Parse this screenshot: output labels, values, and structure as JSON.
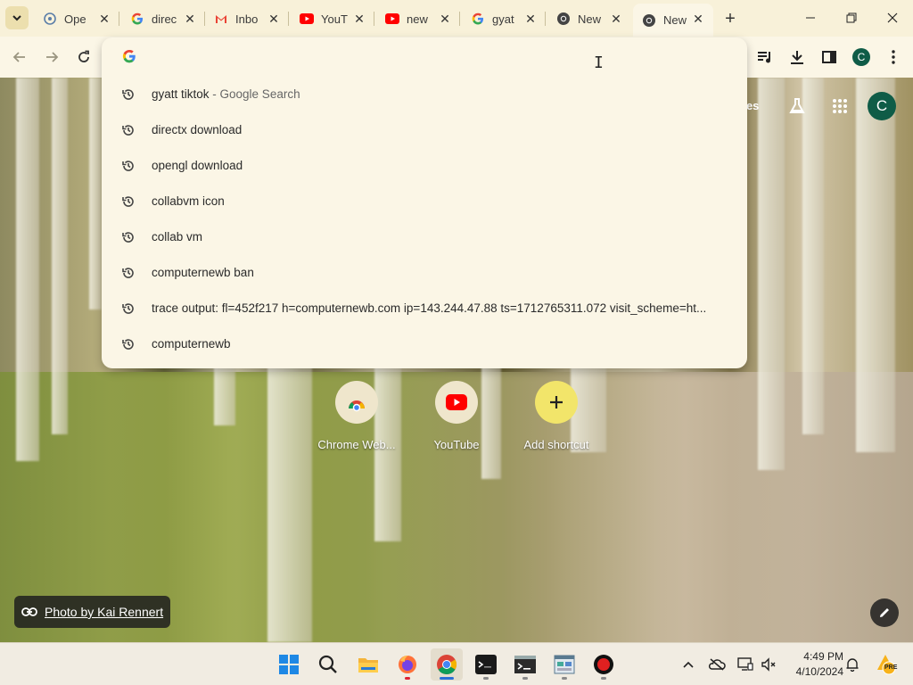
{
  "tabs": [
    {
      "title": "Ope",
      "icon": "openai-icon"
    },
    {
      "title": "direc",
      "icon": "google-icon"
    },
    {
      "title": "Inbo",
      "icon": "gmail-icon"
    },
    {
      "title": "YouT",
      "icon": "youtube-icon"
    },
    {
      "title": "new",
      "icon": "youtube-icon"
    },
    {
      "title": "gyat",
      "icon": "google-icon"
    },
    {
      "title": "New",
      "icon": "chrome-icon"
    },
    {
      "title": "New",
      "icon": "chrome-icon",
      "active": true
    }
  ],
  "toolbar": {
    "profile_initial": "C"
  },
  "omnibox": {
    "value": "",
    "suggestions": [
      {
        "text": "gyatt tiktok",
        "suffix": " - Google Search"
      },
      {
        "text": "directx download",
        "suffix": ""
      },
      {
        "text": "opengl download",
        "suffix": ""
      },
      {
        "text": "collabvm icon",
        "suffix": ""
      },
      {
        "text": "collab vm",
        "suffix": ""
      },
      {
        "text": "computernewb ban",
        "suffix": ""
      },
      {
        "text": "trace output: fl=452f217 h=computernewb.com ip=143.244.47.88 ts=1712765311.072 visit_scheme=ht...",
        "suffix": ""
      },
      {
        "text": "computernewb",
        "suffix": ""
      }
    ]
  },
  "ntp": {
    "images_link": "ges",
    "profile_initial": "C",
    "shortcuts": [
      {
        "label": "Chrome Web...",
        "icon": "chrome-webstore-icon"
      },
      {
        "label": "YouTube",
        "icon": "youtube-icon"
      },
      {
        "label": "Add shortcut",
        "icon": "plus-icon"
      }
    ],
    "photo_credit": "Photo by Kai Rennert"
  },
  "taskbar": {
    "apps": [
      "windows-start-icon",
      "search-icon",
      "file-explorer-icon",
      "firefox-icon",
      "chrome-icon",
      "terminal-app-icon",
      "command-prompt-icon",
      "control-panel-icon",
      "obs-record-icon"
    ],
    "time": "4:49 PM",
    "date": "4/10/2024",
    "badge": "PRE"
  },
  "colors": {
    "accent": "#0f5c47",
    "omnibox_bg": "#fbf6e6",
    "tabstrip_bg": "#f8f1d9"
  }
}
